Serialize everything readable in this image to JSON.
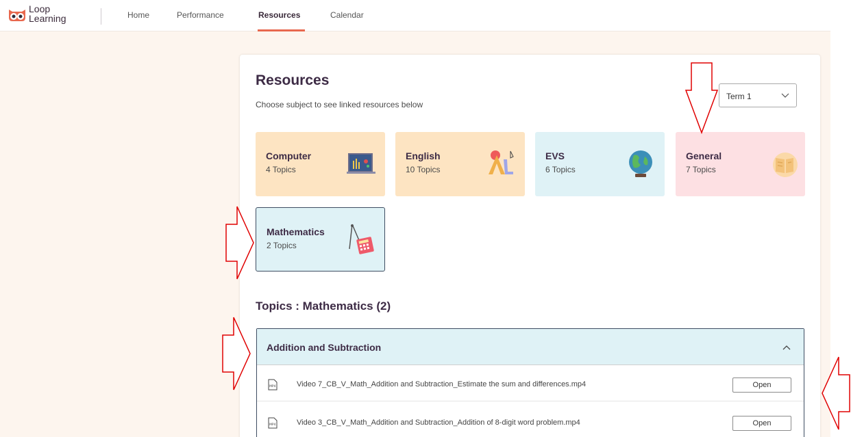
{
  "brand": {
    "line1": "Loop",
    "line2": "Learning"
  },
  "nav": {
    "items": [
      {
        "label": "Home",
        "active": false
      },
      {
        "label": "Performance",
        "active": false
      },
      {
        "label": "Resources",
        "active": true
      },
      {
        "label": "Calendar",
        "active": false
      }
    ]
  },
  "page": {
    "title": "Resources",
    "subtitle": "Choose subject to see linked resources below"
  },
  "term_select": {
    "value": "Term 1"
  },
  "subjects": [
    {
      "name": "Computer",
      "count": "4 Topics",
      "icon": "computer-board-icon",
      "color": "#fde4c2"
    },
    {
      "name": "English",
      "count": "10 Topics",
      "icon": "alphabet-icon",
      "color": "#fde4c2"
    },
    {
      "name": "EVS",
      "count": "6 Topics",
      "icon": "globe-icon",
      "color": "#dff2f6"
    },
    {
      "name": "General",
      "count": "7 Topics",
      "icon": "book-icon",
      "color": "#fde0e3"
    },
    {
      "name": "Mathematics",
      "count": "2 Topics",
      "icon": "calculator-compass-icon",
      "color": "#dff2f6",
      "selected": true
    }
  ],
  "topics": {
    "heading": "Topics : Mathematics (2)",
    "accordion": {
      "title": "Addition and Subtraction",
      "expanded": true,
      "resources": [
        {
          "name": "Video 7_CB_V_Math_Addition and Subtraction_Estimate the sum and differences.mp4",
          "button": "Open"
        },
        {
          "name": "Video 3_CB_V_Math_Addition and Subtraction_Addition of 8-digit word problem.mp4",
          "button": "Open"
        }
      ]
    }
  },
  "colors": {
    "accent": "#e8684e",
    "annotation": "#e00000",
    "title": "#3d2b45"
  }
}
